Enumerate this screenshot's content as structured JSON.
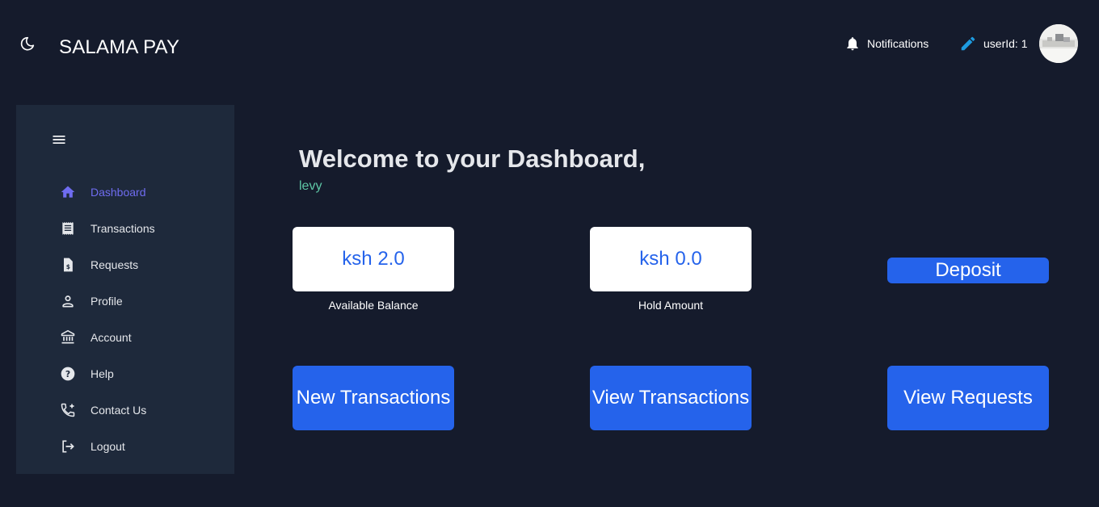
{
  "header": {
    "title": "SALAMA PAY",
    "theme_toggle_icon": "moon-icon",
    "notifications_label": "Notifications",
    "notifications_icon": "bell-icon",
    "user_label": "userId: 1",
    "user_icon": "pencil-icon",
    "avatar_icon": "user-avatar"
  },
  "sidebar": {
    "menu_icon": "hamburger-icon",
    "items": [
      {
        "label": "Dashboard",
        "icon": "home-icon",
        "active": true
      },
      {
        "label": "Transactions",
        "icon": "receipt-icon",
        "active": false
      },
      {
        "label": "Requests",
        "icon": "request-money-icon",
        "active": false
      },
      {
        "label": "Profile",
        "icon": "person-icon",
        "active": false
      },
      {
        "label": "Account",
        "icon": "bank-icon",
        "active": false
      },
      {
        "label": "Help",
        "icon": "help-icon",
        "active": false
      },
      {
        "label": "Contact Us",
        "icon": "phone-add-icon",
        "active": false
      },
      {
        "label": "Logout",
        "icon": "logout-icon",
        "active": false
      }
    ]
  },
  "main": {
    "welcome": "Welcome to your Dashboard,",
    "username": "levy",
    "available_balance": {
      "value": "ksh 2.0",
      "label": "Available Balance"
    },
    "hold_amount": {
      "value": "ksh 0.0",
      "label": "Hold Amount"
    },
    "deposit_label": "Deposit",
    "actions": [
      "New Transactions",
      "View Transactions",
      "View Requests"
    ]
  },
  "colors": {
    "background": "#151b2c",
    "sidebar": "#1e293b",
    "accent": "#2563eb",
    "active_nav": "#6f6cf0",
    "username": "#5ec7a6"
  }
}
